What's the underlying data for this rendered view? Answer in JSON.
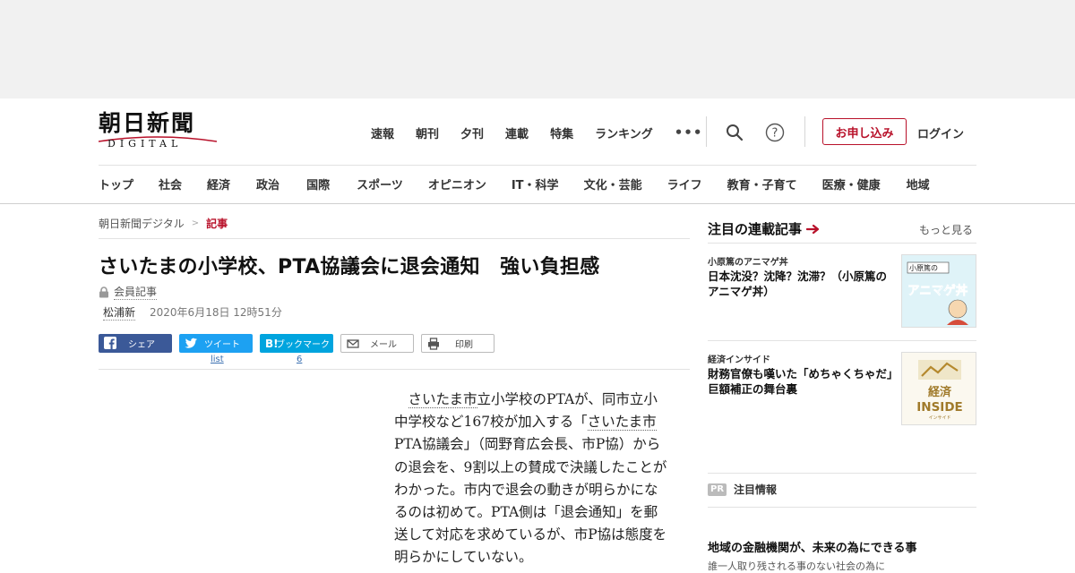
{
  "logo": {
    "main": "朝日新聞",
    "sub": "DIGITAL"
  },
  "top_nav": [
    "速報",
    "朝刊",
    "夕刊",
    "連載",
    "特集",
    "ランキング"
  ],
  "more_label": "•••",
  "signup_label": "お申し込み",
  "login_label": "ログイン",
  "categories": [
    "トップ",
    "社会",
    "経済",
    "政治",
    "国際",
    "スポーツ",
    "オピニオン",
    "IT・科学",
    "文化・芸能",
    "ライフ",
    "教育・子育て",
    "医療・健康",
    "地域"
  ],
  "breadcrumb": {
    "home": "朝日新聞デジタル",
    "separator": ">",
    "current": "記事"
  },
  "article": {
    "title": "さいたまの小学校、PTA協議会に退会通知　強い負担感",
    "member_label": "会員記事",
    "author": "松浦新",
    "date": "2020年6月18日 12時51分",
    "body": {
      "p1": "さいたま市",
      "p2": "立小学校のPTAが、同市立小中学校など167校が加入する「",
      "p3": "さいたま市",
      "p4": "PTA協議会」（岡野育広会長、市P協）からの退会を、9割以上の賛成で決議したことがわかった。市内で退会の動きが明らかになるのは初めて。PTA側は「退会通知」を郵送して対応を求めているが、市P協は態度を明らかにしていない。"
    }
  },
  "share": {
    "facebook": "シェア",
    "twitter": "ツイート",
    "hatena": "ブックマーク",
    "mail": "メール",
    "print": "印刷",
    "twitter_count": "list",
    "hatena_count": "6"
  },
  "sidebar": {
    "heading": "注目の連載記事",
    "more": "もっと見る",
    "items": [
      {
        "category": "小原篤のアニマゲ丼",
        "headline": "日本沈没？沈降？沈滞？（小原篤のアニマゲ丼）",
        "thumb_label": "小原篤の",
        "thumb_big": "アニマゲ丼"
      },
      {
        "category": "経済インサイド",
        "headline": "財務官僚も嘆いた「めちゃくちゃだ」　巨額補正の舞台裏",
        "thumb_label": "経済",
        "thumb_big": "INSIDE",
        "thumb_small": "インサイド"
      }
    ],
    "pr_badge": "PR",
    "pr_heading": "注目情報",
    "pr_title": "地域の金融機関が、未来の為にできる事",
    "pr_sub": "誰一人取り残される事のない社会の為に"
  },
  "colors": {
    "brand_red": "#b8112a",
    "facebook": "#3b5998",
    "twitter": "#1da1f2",
    "hatena": "#00a4de"
  }
}
